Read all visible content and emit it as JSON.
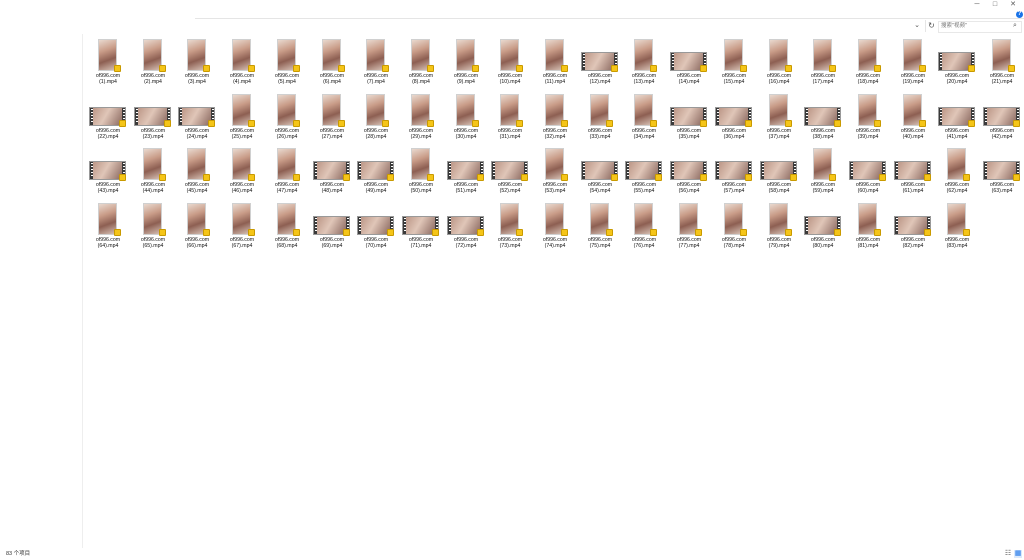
{
  "window": {
    "minimize_glyph": "─",
    "maximize_glyph": "□",
    "close_glyph": "✕",
    "help_glyph": "?"
  },
  "addressbar": {
    "dropdown_glyph": "⌄",
    "refresh_glyph": "↻",
    "search_placeholder": "搜索\"视频\"",
    "search_glyph": "⌕"
  },
  "files": {
    "items": [
      {
        "name": "of996.com\n(1).mp4",
        "thumb": "portrait"
      },
      {
        "name": "of996.com\n(2).mp4",
        "thumb": "portrait"
      },
      {
        "name": "of996.com\n(3).mp4",
        "thumb": "portrait"
      },
      {
        "name": "of996.com\n(4).mp4",
        "thumb": "portrait"
      },
      {
        "name": "of996.com\n(5).mp4",
        "thumb": "portrait"
      },
      {
        "name": "of996.com\n(6).mp4",
        "thumb": "portrait"
      },
      {
        "name": "of996.com\n(7).mp4",
        "thumb": "portrait"
      },
      {
        "name": "of996.com\n(8).mp4",
        "thumb": "portrait"
      },
      {
        "name": "of996.com\n(9).mp4",
        "thumb": "portrait"
      },
      {
        "name": "of996.com\n(10).mp4",
        "thumb": "portrait"
      },
      {
        "name": "of996.com\n(11).mp4",
        "thumb": "portrait"
      },
      {
        "name": "of996.com\n(12).mp4",
        "thumb": "landscape"
      },
      {
        "name": "of996.com\n(13).mp4",
        "thumb": "portrait"
      },
      {
        "name": "of996.com\n(14).mp4",
        "thumb": "landscape"
      },
      {
        "name": "of996.com\n(15).mp4",
        "thumb": "portrait"
      },
      {
        "name": "of996.com\n(16).mp4",
        "thumb": "portrait"
      },
      {
        "name": "of996.com\n(17).mp4",
        "thumb": "portrait"
      },
      {
        "name": "of996.com\n(18).mp4",
        "thumb": "portrait"
      },
      {
        "name": "of996.com\n(19).mp4",
        "thumb": "portrait"
      },
      {
        "name": "of996.com\n(20).mp4",
        "thumb": "landscape"
      },
      {
        "name": "of996.com\n(21).mp4",
        "thumb": "portrait"
      },
      {
        "name": "of996.com\n(22).mp4",
        "thumb": "landscape"
      },
      {
        "name": "of996.com\n(23).mp4",
        "thumb": "landscape"
      },
      {
        "name": "of996.com\n(24).mp4",
        "thumb": "landscape"
      },
      {
        "name": "of996.com\n(25).mp4",
        "thumb": "portrait"
      },
      {
        "name": "of996.com\n(26).mp4",
        "thumb": "portrait"
      },
      {
        "name": "of996.com\n(27).mp4",
        "thumb": "portrait"
      },
      {
        "name": "of996.com\n(28).mp4",
        "thumb": "portrait"
      },
      {
        "name": "of996.com\n(29).mp4",
        "thumb": "portrait"
      },
      {
        "name": "of996.com\n(30).mp4",
        "thumb": "portrait"
      },
      {
        "name": "of996.com\n(31).mp4",
        "thumb": "portrait"
      },
      {
        "name": "of996.com\n(32).mp4",
        "thumb": "portrait"
      },
      {
        "name": "of996.com\n(33).mp4",
        "thumb": "portrait"
      },
      {
        "name": "of996.com\n(34).mp4",
        "thumb": "portrait"
      },
      {
        "name": "of996.com\n(35).mp4",
        "thumb": "landscape"
      },
      {
        "name": "of996.com\n(36).mp4",
        "thumb": "landscape"
      },
      {
        "name": "of996.com\n(37).mp4",
        "thumb": "portrait"
      },
      {
        "name": "of996.com\n(38).mp4",
        "thumb": "landscape"
      },
      {
        "name": "of996.com\n(39).mp4",
        "thumb": "portrait"
      },
      {
        "name": "of996.com\n(40).mp4",
        "thumb": "portrait"
      },
      {
        "name": "of996.com\n(41).mp4",
        "thumb": "landscape"
      },
      {
        "name": "of996.com\n(42).mp4",
        "thumb": "landscape"
      },
      {
        "name": "of996.com\n(43).mp4",
        "thumb": "landscape"
      },
      {
        "name": "of996.com\n(44).mp4",
        "thumb": "portrait"
      },
      {
        "name": "of996.com\n(45).mp4",
        "thumb": "portrait"
      },
      {
        "name": "of996.com\n(46).mp4",
        "thumb": "portrait"
      },
      {
        "name": "of996.com\n(47).mp4",
        "thumb": "portrait"
      },
      {
        "name": "of996.com\n(48).mp4",
        "thumb": "landscape"
      },
      {
        "name": "of996.com\n(49).mp4",
        "thumb": "landscape"
      },
      {
        "name": "of996.com\n(50).mp4",
        "thumb": "portrait"
      },
      {
        "name": "of996.com\n(51).mp4",
        "thumb": "landscape"
      },
      {
        "name": "of996.com\n(52).mp4",
        "thumb": "landscape"
      },
      {
        "name": "of996.com\n(53).mp4",
        "thumb": "portrait"
      },
      {
        "name": "of996.com\n(54).mp4",
        "thumb": "landscape"
      },
      {
        "name": "of996.com\n(55).mp4",
        "thumb": "landscape"
      },
      {
        "name": "of996.com\n(56).mp4",
        "thumb": "landscape"
      },
      {
        "name": "of996.com\n(57).mp4",
        "thumb": "landscape"
      },
      {
        "name": "of996.com\n(58).mp4",
        "thumb": "landscape"
      },
      {
        "name": "of996.com\n(59).mp4",
        "thumb": "portrait"
      },
      {
        "name": "of996.com\n(60).mp4",
        "thumb": "landscape"
      },
      {
        "name": "of996.com\n(61).mp4",
        "thumb": "landscape"
      },
      {
        "name": "of996.com\n(62).mp4",
        "thumb": "portrait"
      },
      {
        "name": "of996.com\n(63).mp4",
        "thumb": "landscape"
      },
      {
        "name": "of996.com\n(64).mp4",
        "thumb": "portrait"
      },
      {
        "name": "of996.com\n(65).mp4",
        "thumb": "portrait"
      },
      {
        "name": "of996.com\n(66).mp4",
        "thumb": "portrait"
      },
      {
        "name": "of996.com\n(67).mp4",
        "thumb": "portrait"
      },
      {
        "name": "of996.com\n(68).mp4",
        "thumb": "portrait"
      },
      {
        "name": "of996.com\n(69).mp4",
        "thumb": "landscape"
      },
      {
        "name": "of996.com\n(70).mp4",
        "thumb": "landscape"
      },
      {
        "name": "of996.com\n(71).mp4",
        "thumb": "landscape"
      },
      {
        "name": "of996.com\n(72).mp4",
        "thumb": "landscape"
      },
      {
        "name": "of996.com\n(73).mp4",
        "thumb": "portrait"
      },
      {
        "name": "of996.com\n(74).mp4",
        "thumb": "portrait"
      },
      {
        "name": "of996.com\n(75).mp4",
        "thumb": "portrait"
      },
      {
        "name": "of996.com\n(76).mp4",
        "thumb": "portrait"
      },
      {
        "name": "of996.com\n(77).mp4",
        "thumb": "portrait"
      },
      {
        "name": "of996.com\n(78).mp4",
        "thumb": "portrait"
      },
      {
        "name": "of996.com\n(79).mp4",
        "thumb": "portrait"
      },
      {
        "name": "of996.com\n(80).mp4",
        "thumb": "landscape"
      },
      {
        "name": "of996.com\n(81).mp4",
        "thumb": "portrait"
      },
      {
        "name": "of996.com\n(82).mp4",
        "thumb": "landscape"
      },
      {
        "name": "of996.com\n(83).mp4",
        "thumb": "portrait"
      }
    ]
  },
  "statusbar": {
    "item_count": "83 个项目",
    "details_view_glyph": "☷",
    "tiles_view_glyph": "▦"
  },
  "colors": {
    "accent": "#1a73e8",
    "badge": "#f5c518"
  }
}
